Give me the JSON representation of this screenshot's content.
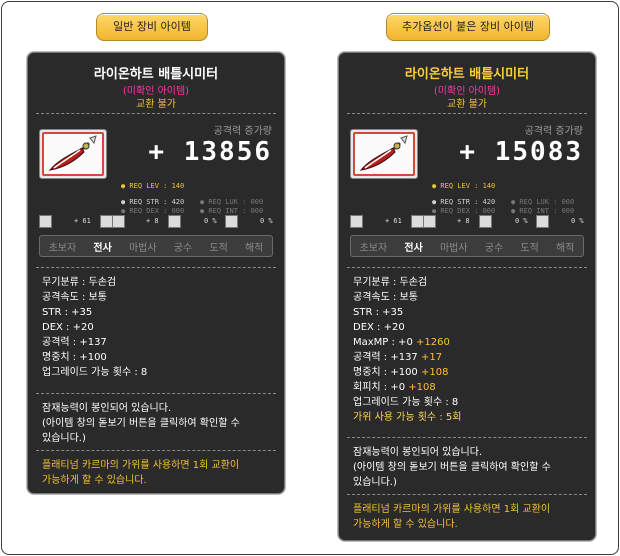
{
  "labels": {
    "left_tab": "일반 장비 아이템",
    "right_tab": "추가옵션이 붙은 장비 아이템"
  },
  "left": {
    "name": "라이온하트 배틀시미터",
    "name_color": "#ffffff",
    "unidentified": "(미확인 아이템)",
    "trade": "교환 불가",
    "power_label": "공격력 증가량",
    "power_value": "+ 13856",
    "req_lev": "● REQ LEV : 140",
    "req_str": "● REQ STR : 420",
    "req_luk": "● REQ LUK : 000",
    "req_dex": "● REQ DEX : 000",
    "req_int": "● REQ INT : 000",
    "mini1": "+ 61",
    "mini2": "+ 8",
    "mini3": "0 %",
    "mini4": "0 %",
    "jobs": [
      "초보자",
      "전사",
      "마법사",
      "궁수",
      "도적",
      "해적"
    ],
    "stats": [
      "무기분류 : 두손검",
      "공격속도 : 보통",
      "STR : +35",
      "DEX : +20",
      "공격력 : +137",
      "명중치 : +100",
      "업그레이드 가능 횟수 : 8"
    ],
    "potential": [
      "잠재능력이 봉인되어 있습니다.",
      "(아이템 창의 돋보기 버튼을 클릭하여 확인할 수",
      "  있습니다.)"
    ],
    "karma": [
      "플래티넘 카르마의 가위를 사용하면 1회 교환이",
      "가능하게 할 수 있습니다."
    ]
  },
  "right": {
    "name": "라이온하트 배틀시미터",
    "name_color": "#ffcc33",
    "unidentified": "(미확인 아이템)",
    "trade": "교환 불가",
    "power_label": "공격력 증가량",
    "power_value": "+ 15083",
    "req_lev": "● REQ LEV : 140",
    "req_str": "● REQ STR : 420",
    "req_luk": "● REQ LUK : 000",
    "req_dex": "● REQ DEX : 000",
    "req_int": "● REQ INT : 000",
    "mini1": "+ 61",
    "mini2": "+ 8",
    "mini3": "0 %",
    "mini4": "0 %",
    "jobs": [
      "초보자",
      "전사",
      "마법사",
      "궁수",
      "도적",
      "해적"
    ],
    "stats": [
      {
        "base": "무기분류 : 두손검",
        "bonus": ""
      },
      {
        "base": "공격속도 : 보통",
        "bonus": ""
      },
      {
        "base": "STR : +35",
        "bonus": ""
      },
      {
        "base": "DEX : +20",
        "bonus": ""
      },
      {
        "base": "MaxMP : +0 ",
        "bonus": "+1260"
      },
      {
        "base": "공격력 : +137 ",
        "bonus": "+17"
      },
      {
        "base": "명중치 : +100 ",
        "bonus": "+108"
      },
      {
        "base": "회피치 : +0 ",
        "bonus": "+108"
      },
      {
        "base": "업그레이드 가능 횟수 : 8",
        "bonus": ""
      }
    ],
    "scissors": "가위 사용 가능 횟수 : 5회",
    "potential": [
      "잠재능력이 봉인되어 있습니다.",
      "(아이템 창의 돋보기 버튼을 클릭하여 확인할 수",
      "  있습니다.)"
    ],
    "karma": [
      "플래티넘 카르마의 가위를 사용하면 1회 교환이",
      "가능하게 할 수 있습니다."
    ]
  }
}
